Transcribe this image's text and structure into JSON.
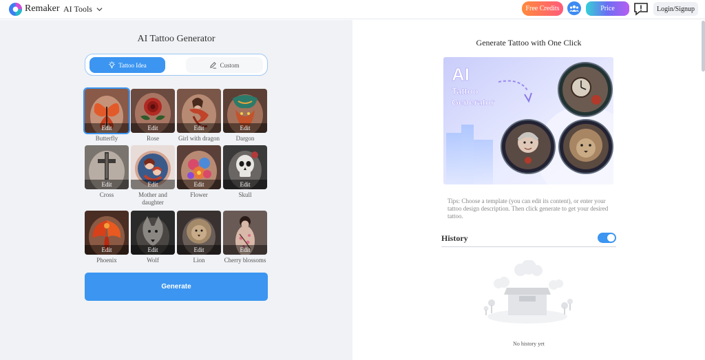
{
  "header": {
    "brand": "Remaker",
    "ai_tools": "AI Tools",
    "free_credits": "Free Credits",
    "price": "Price",
    "login": "Login/Signup"
  },
  "left": {
    "title": "AI Tattoo Generator",
    "tabs": {
      "idea": "Tattoo Idea",
      "custom": "Custom"
    },
    "edit_label": "Edit",
    "items": [
      {
        "label": "Butterfly"
      },
      {
        "label": "Rose"
      },
      {
        "label": "Girl with dragon"
      },
      {
        "label": "Dargon"
      },
      {
        "label": "Cross"
      },
      {
        "label": "Mother and daughter"
      },
      {
        "label": "Flower"
      },
      {
        "label": "Skull"
      },
      {
        "label": "Phoenix"
      },
      {
        "label": "Wolf"
      },
      {
        "label": "Lion"
      },
      {
        "label": "Cherry blossoms"
      }
    ],
    "generate": "Generate"
  },
  "right": {
    "title": "Generate Tattoo with One Click",
    "banner": {
      "line1": "AI",
      "line2": "Tattoo",
      "line3": "Generator"
    },
    "tips": "Tips: Choose a template (you can edit its content), or enter your tattoo design description. Then click generate to get your desired tattoo.",
    "history": "History",
    "history_toggle": "on",
    "empty": "No history yet"
  },
  "colors": {
    "accent": "#3b95f1",
    "panel_bg": "#f0f2f5"
  },
  "icons": [
    "remaker-logo-icon",
    "chevron-down-icon",
    "community-icon",
    "feedback-icon",
    "lightbulb-icon",
    "pencil-icon"
  ]
}
